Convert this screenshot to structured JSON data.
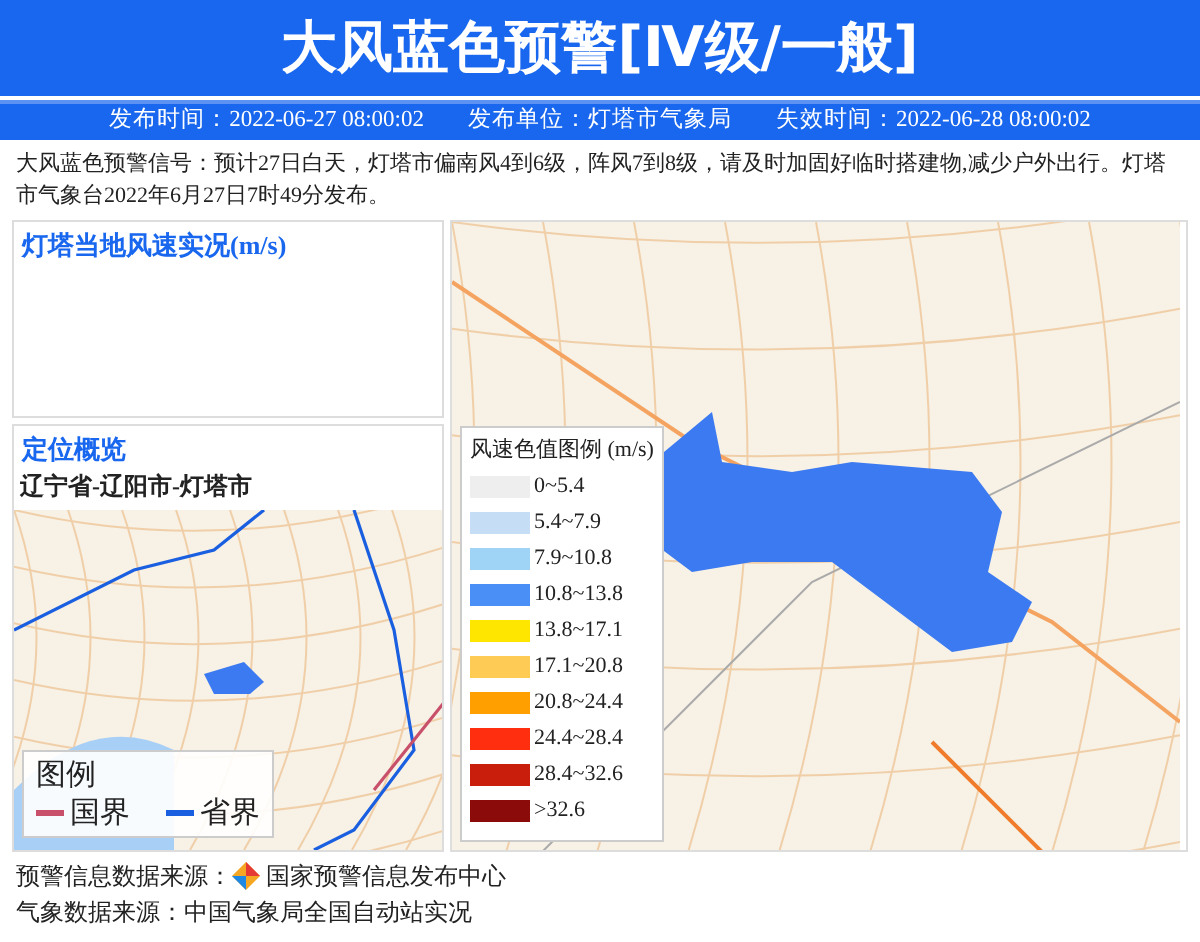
{
  "header": {
    "title": "大风蓝色预警[Ⅳ级/一般]"
  },
  "meta": [
    "发布时间：2022-06-27 08:00:02",
    "发布单位：灯塔市气象局",
    "失效时间：2022-06-28 08:00:02"
  ],
  "description": "大风蓝色预警信号：预计27日白天，灯塔市偏南风4到6级，阵风7到8级，请及时加固好临时搭建物,减少户外出行。灯塔市气象台2022年6月27日7时49分发布。",
  "wind_panel": {
    "title": "灯塔当地风速实况(m/s)"
  },
  "location_panel": {
    "title": "定位概览",
    "region": "辽宁省-辽阳市-灯塔市",
    "legend": {
      "title": "图例",
      "items": [
        {
          "label": "国界",
          "color": "#c8506a"
        },
        {
          "label": "省界",
          "color": "#1a5fe0"
        }
      ]
    }
  },
  "map_legend": {
    "title": "风速色值图例 (m/s)",
    "items": [
      {
        "label": "0~5.4",
        "color": "#eeeeee"
      },
      {
        "label": "5.4~7.9",
        "color": "#c5def5"
      },
      {
        "label": "7.9~10.8",
        "color": "#a0d4f7"
      },
      {
        "label": "10.8~13.8",
        "color": "#4a8ff5"
      },
      {
        "label": "13.8~17.1",
        "color": "#ffe600"
      },
      {
        "label": "17.1~20.8",
        "color": "#fecb55"
      },
      {
        "label": "20.8~24.4",
        "color": "#ff9f00"
      },
      {
        "label": "24.4~28.4",
        "color": "#ff2e0e"
      },
      {
        "label": "28.4~32.6",
        "color": "#c81e0b"
      },
      {
        "label": ">32.6",
        "color": "#8b0a0a"
      }
    ]
  },
  "footer": [
    {
      "label": "预警信息数据来源：",
      "source": "国家预警信息发布中心",
      "logo": true
    },
    {
      "label": "气象数据来源：",
      "source": "中国气象局全国自动站实况",
      "logo": false
    }
  ]
}
